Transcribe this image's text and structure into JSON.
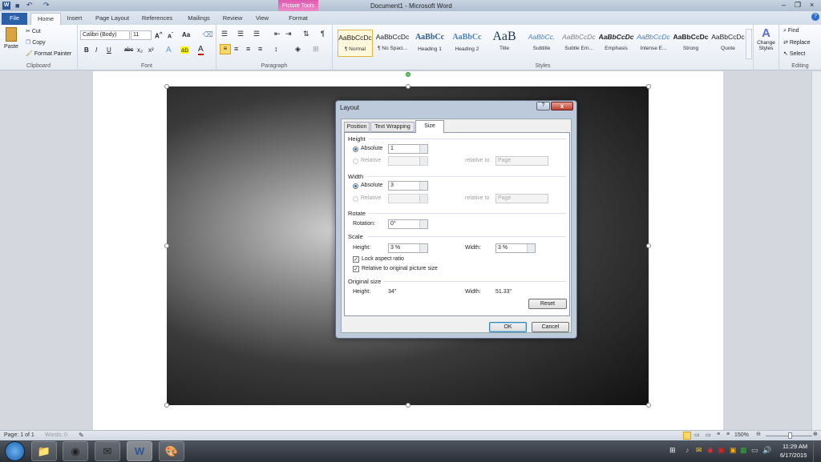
{
  "window": {
    "title": "Document1 - Microsoft Word",
    "contextual": "Picture Tools"
  },
  "tabs": [
    "File",
    "Home",
    "Insert",
    "Page Layout",
    "References",
    "Mailings",
    "Review",
    "View",
    "Format"
  ],
  "clipboard": {
    "paste": "Paste",
    "cut": "Cut",
    "copy": "Copy",
    "format_painter": "Format Painter",
    "label": "Clipboard"
  },
  "font": {
    "name": "Calibri (Body)",
    "size": "11",
    "label": "Font",
    "bold": "B",
    "italic": "I",
    "underline": "U",
    "case": "Aa"
  },
  "paragraph": {
    "label": "Paragraph",
    "marks": "¶"
  },
  "styles": {
    "label": "Styles",
    "items": [
      {
        "preview": "AaBbCcDc",
        "name": "¶ Normal",
        "color": "#222"
      },
      {
        "preview": "AaBbCcDc",
        "name": "¶ No Spaci...",
        "color": "#222"
      },
      {
        "preview": "AaBbCc",
        "name": "Heading 1",
        "color": "#2f5d95"
      },
      {
        "preview": "AaBbCc",
        "name": "Heading 2",
        "color": "#4f81bd"
      },
      {
        "preview": "AaB",
        "name": "Title",
        "color": "#17365d"
      },
      {
        "preview": "AaBbCc.",
        "name": "Subtitle",
        "color": "#4f81bd"
      },
      {
        "preview": "AaBbCcDc",
        "name": "Subtle Em...",
        "color": "#808080"
      },
      {
        "preview": "AaBbCcDc",
        "name": "Emphasis",
        "color": "#222"
      },
      {
        "preview": "AaBbCcDc",
        "name": "Intense E...",
        "color": "#4f81bd"
      },
      {
        "preview": "AaBbCcDc",
        "name": "Strong",
        "color": "#222"
      },
      {
        "preview": "AaBbCcDc",
        "name": "Quote",
        "color": "#222"
      }
    ],
    "change": "Change Styles"
  },
  "editing": {
    "find": "Find",
    "replace": "Replace",
    "select": "Select",
    "label": "Editing"
  },
  "dialog": {
    "title": "Layout",
    "help": "?",
    "close": "x",
    "tabs": [
      "Position",
      "Text Wrapping",
      "Size"
    ],
    "height": {
      "label": "Height",
      "absolute": "Absolute",
      "absolute_value": "1",
      "relative": "Relative",
      "relative_to": "relative to",
      "relative_to_value": "Page"
    },
    "width": {
      "label": "Width",
      "absolute": "Absolute",
      "absolute_value": "3",
      "relative": "Relative",
      "relative_to": "relative to",
      "relative_to_value": "Page"
    },
    "rotate": {
      "label": "Rotate",
      "rotation": "Rotation:",
      "value": "0°"
    },
    "scale": {
      "label": "Scale",
      "height": "Height:",
      "height_value": "3 %",
      "width": "Width:",
      "width_value": "3 %",
      "lock": "Lock aspect ratio",
      "lock_checked": true,
      "relative": "Relative to original picture size",
      "relative_checked": true
    },
    "original": {
      "label": "Original size",
      "height": "Height:",
      "height_value": "34\"",
      "width": "Width:",
      "width_value": "51.33\""
    },
    "reset": "Reset",
    "ok": "OK",
    "cancel": "Cancel"
  },
  "status": {
    "page": "Page: 1 of 1",
    "words": "Words: 0",
    "zoom": "150%"
  },
  "taskbar": {
    "time": "11:29 AM",
    "date": "6/17/2015"
  }
}
